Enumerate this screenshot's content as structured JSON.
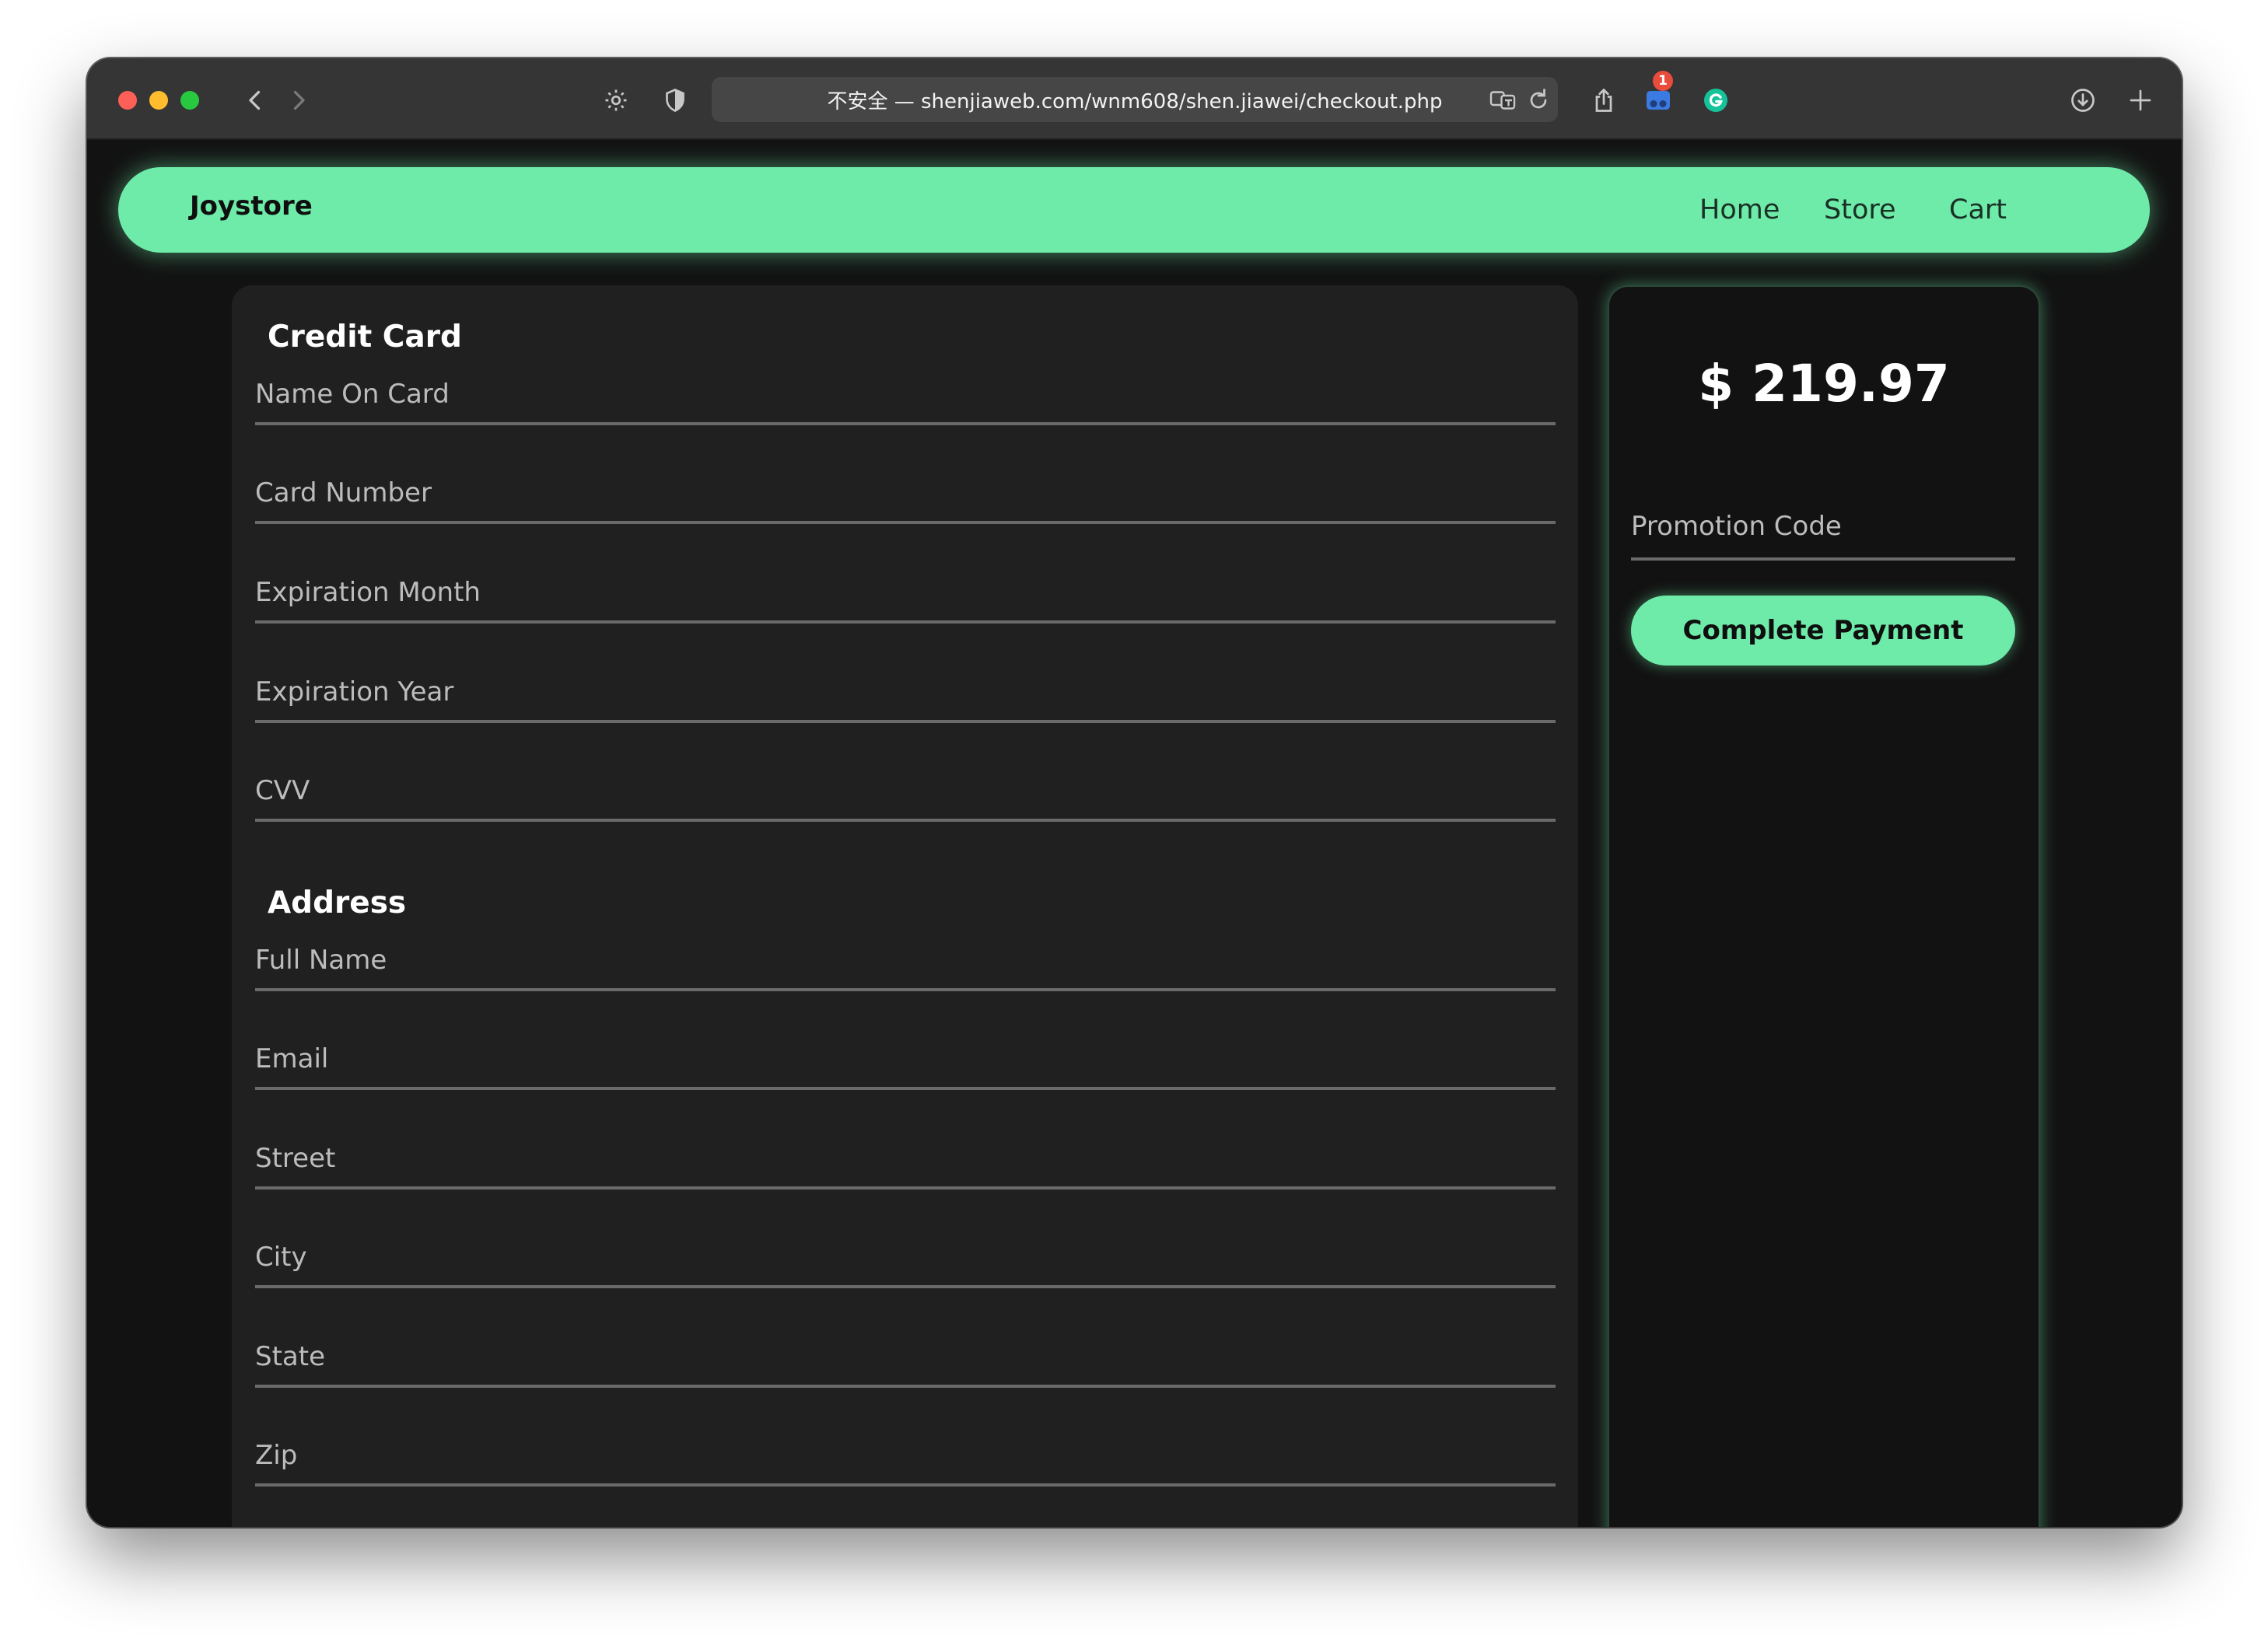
{
  "browser": {
    "url_text": "不安全 — shenjiaweb.com/wnm608/shen.jiawei/checkout.php",
    "extension_badge": "1"
  },
  "navbar": {
    "brand": "Joystore",
    "links": [
      "Home",
      "Store",
      "Cart"
    ]
  },
  "credit_card": {
    "title": "Credit Card",
    "fields": [
      "Name On Card",
      "Card Number",
      "Expiration Month",
      "Expiration Year",
      "CVV"
    ]
  },
  "address": {
    "title": "Address",
    "fields": [
      "Full Name",
      "Email",
      "Street",
      "City",
      "State",
      "Zip"
    ]
  },
  "summary": {
    "total": "$ 219.97",
    "promo_placeholder": "Promotion Code",
    "pay_label": "Complete Payment"
  },
  "colors": {
    "accent": "#6eeba8",
    "page_bg": "#121212",
    "panel_bg": "#202020"
  }
}
